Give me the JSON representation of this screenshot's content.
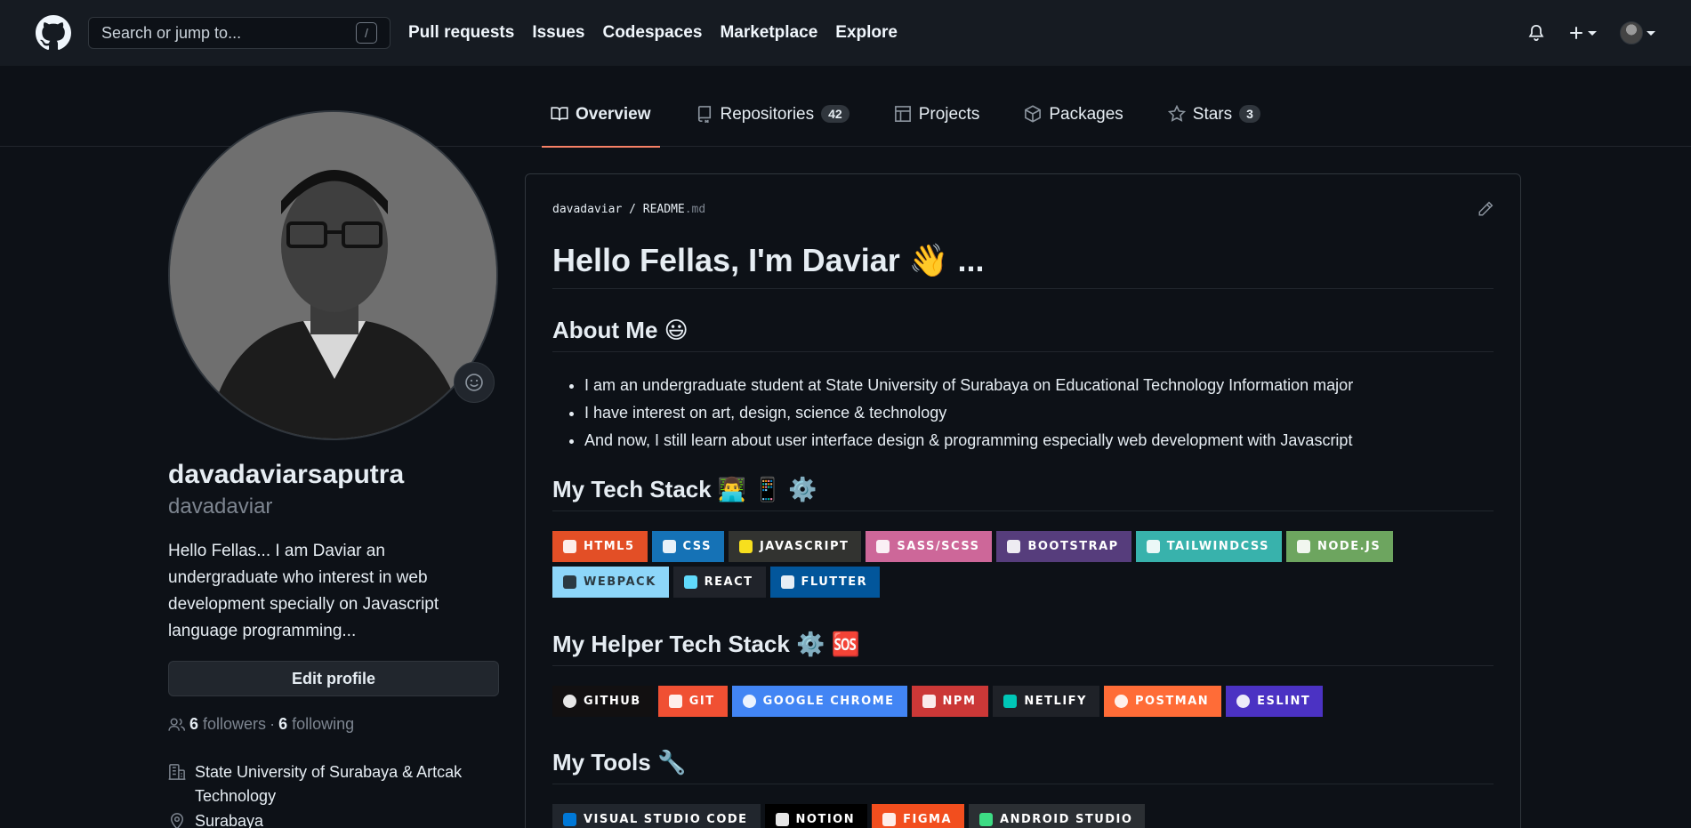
{
  "header": {
    "search_placeholder": "Search or jump to...",
    "search_shortcut": "/",
    "nav": [
      "Pull requests",
      "Issues",
      "Codespaces",
      "Marketplace",
      "Explore"
    ]
  },
  "tabs": [
    {
      "label": "Overview",
      "count": null,
      "active": true,
      "icon": "book-icon"
    },
    {
      "label": "Repositories",
      "count": "42",
      "active": false,
      "icon": "repo-icon"
    },
    {
      "label": "Projects",
      "count": null,
      "active": false,
      "icon": "table-icon"
    },
    {
      "label": "Packages",
      "count": null,
      "active": false,
      "icon": "package-icon"
    },
    {
      "label": "Stars",
      "count": "3",
      "active": false,
      "icon": "star-icon"
    }
  ],
  "profile": {
    "fullname": "davadaviarsaputra",
    "username": "davadaviar",
    "bio": "Hello Fellas... I am Daviar an undergraduate who interest in web development specially on Javascript language programming...",
    "edit_button": "Edit profile",
    "followers_count": "6",
    "followers_label": "followers",
    "following_count": "6",
    "following_label": "following",
    "separator": "·",
    "organization": "State University of Surabaya & Artcak Technology",
    "location": "Surabaya"
  },
  "readme": {
    "owner": "davadaviar",
    "file": "README",
    "ext": ".md",
    "title": "Hello Fellas, I'm Daviar 👋 ...",
    "about_heading": "About Me 😃",
    "about_items": [
      "I am an undergraduate student at State University of Surabaya on Educational Technology Information major",
      "I have interest on art, design, science & technology",
      "And now, I still learn about user interface design & programming especially web development with Javascript"
    ],
    "tech_heading": "My Tech Stack 👨‍💻 📱 ⚙️",
    "tech_badges": [
      {
        "label": "HTML5",
        "color": "#e34f26"
      },
      {
        "label": "CSS",
        "color": "#1572b6"
      },
      {
        "label": "JAVASCRIPT",
        "color": "#323330"
      },
      {
        "label": "SASS/SCSS",
        "color": "#cd6799"
      },
      {
        "label": "BOOTSTRAP",
        "color": "#563d7c"
      },
      {
        "label": "TAILWINDCSS",
        "color": "#38b2ac"
      },
      {
        "label": "NODE.JS",
        "color": "#6da55f"
      },
      {
        "label": "WEBPACK",
        "color": "#8dd6f9"
      },
      {
        "label": "REACT",
        "color": "#20232a"
      },
      {
        "label": "FLUTTER",
        "color": "#02569b"
      }
    ],
    "helper_heading": "My Helper Tech Stack ⚙️ 🆘",
    "helper_badges": [
      {
        "label": "GITHUB",
        "color": "#121011"
      },
      {
        "label": "GIT",
        "color": "#f05033"
      },
      {
        "label": "GOOGLE CHROME",
        "color": "#4285f4"
      },
      {
        "label": "NPM",
        "color": "#cb3837"
      },
      {
        "label": "NETLIFY",
        "color": "#1f2228"
      },
      {
        "label": "POSTMAN",
        "color": "#ff6c37"
      },
      {
        "label": "ESLINT",
        "color": "#4b32c3"
      }
    ],
    "tools_heading": "My Tools 🔧",
    "tools_badges": [
      {
        "label": "VISUAL STUDIO CODE",
        "color": "#21262d"
      },
      {
        "label": "NOTION",
        "color": "#000000"
      },
      {
        "label": "FIGMA",
        "color": "#f24e1e"
      },
      {
        "label": "ANDROID STUDIO",
        "color": "#2b2f33"
      }
    ]
  }
}
